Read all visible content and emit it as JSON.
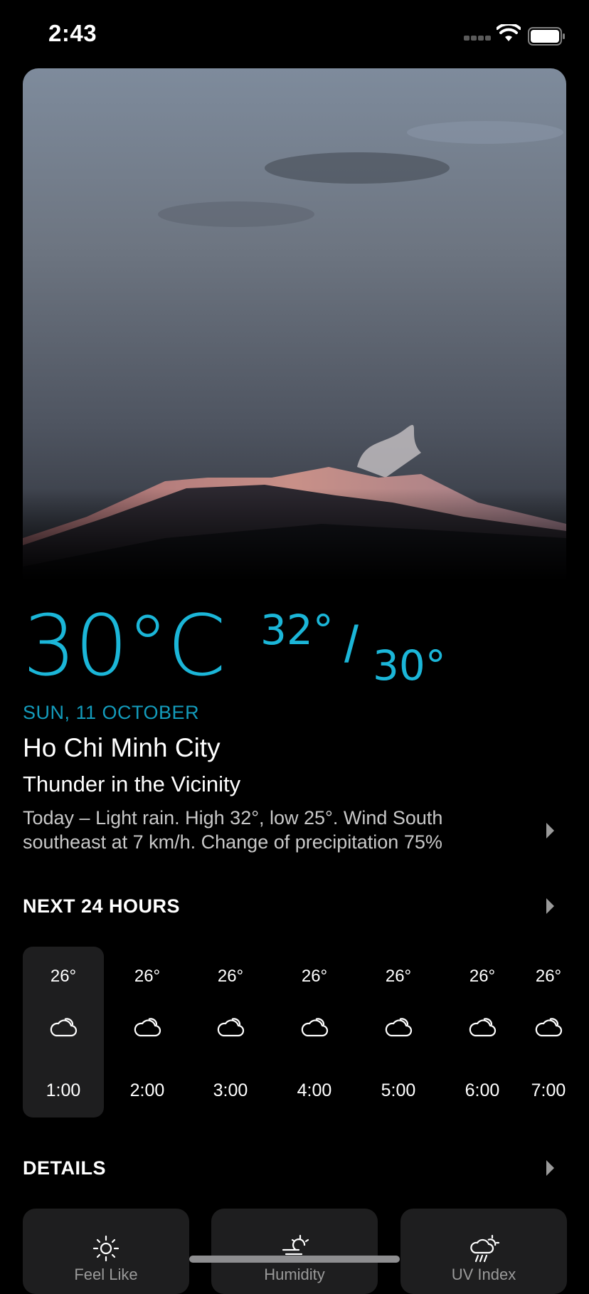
{
  "status_bar": {
    "time": "2:43"
  },
  "weather": {
    "current_temp": "30°C",
    "high": "32°",
    "separator": "/",
    "low": "30°",
    "date": "SUN, 11 OCTOBER",
    "city": "Ho Chi Minh City",
    "condition": "Thunder in the Vicinity",
    "summary": "Today – Light rain. High 32°, low 25°. Wind South southeast at 7 km/h. Change of precipitation 75%"
  },
  "hourly": {
    "title": "NEXT 24 HOURS",
    "items": [
      {
        "temp": "26°",
        "time": "1:00",
        "icon": "cloud-icon"
      },
      {
        "temp": "26°",
        "time": "2:00",
        "icon": "cloud-icon"
      },
      {
        "temp": "26°",
        "time": "3:00",
        "icon": "cloud-icon"
      },
      {
        "temp": "26°",
        "time": "4:00",
        "icon": "cloud-icon"
      },
      {
        "temp": "26°",
        "time": "5:00",
        "icon": "cloud-icon"
      },
      {
        "temp": "26°",
        "time": "6:00",
        "icon": "cloud-icon"
      },
      {
        "temp": "26°",
        "time": "7:00",
        "icon": "cloud-icon"
      }
    ]
  },
  "details": {
    "title": "DETAILS",
    "cards": [
      {
        "icon": "sun-icon",
        "label": "Feel Like"
      },
      {
        "icon": "wind-sun-icon",
        "label": "Humidity"
      },
      {
        "icon": "rain-sun-icon",
        "label": "UV Index"
      }
    ]
  },
  "colors": {
    "accent": "#1bb6d8",
    "card_bg": "#1e1e1f",
    "background": "#000000"
  }
}
